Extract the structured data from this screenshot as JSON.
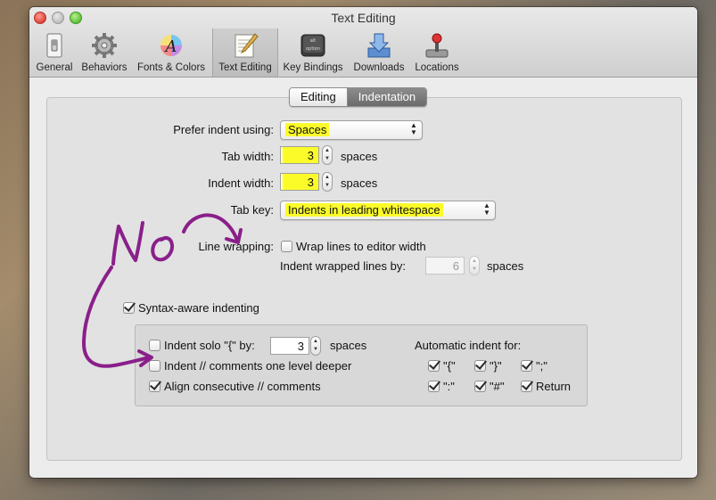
{
  "window": {
    "title": "Text Editing"
  },
  "toolbar": {
    "items": [
      {
        "label": "General",
        "icon": "light-switch-icon"
      },
      {
        "label": "Behaviors",
        "icon": "gear-icon"
      },
      {
        "label": "Fonts & Colors",
        "icon": "fonts-colors-icon"
      },
      {
        "label": "Text Editing",
        "icon": "text-editing-icon",
        "active": true
      },
      {
        "label": "Key Bindings",
        "icon": "option-key-icon"
      },
      {
        "label": "Downloads",
        "icon": "downloads-icon"
      },
      {
        "label": "Locations",
        "icon": "joystick-icon"
      }
    ]
  },
  "tabs": {
    "editing": "Editing",
    "indentation": "Indentation",
    "selected": "Indentation"
  },
  "indentation": {
    "prefer_indent_label": "Prefer indent using:",
    "prefer_indent_value": "Spaces",
    "tab_width_label": "Tab width:",
    "tab_width_value": "3",
    "tab_width_unit": "spaces",
    "indent_width_label": "Indent width:",
    "indent_width_value": "3",
    "indent_width_unit": "spaces",
    "tab_key_label": "Tab key:",
    "tab_key_value": "Indents in leading whitespace",
    "line_wrapping_label": "Line wrapping:",
    "wrap_lines_label": "Wrap lines to editor width",
    "wrap_lines_checked": false,
    "indent_wrapped_label": "Indent wrapped lines by:",
    "indent_wrapped_value": "6",
    "indent_wrapped_unit": "spaces",
    "syntax_aware_label": "Syntax-aware indenting",
    "syntax_aware_checked": true,
    "indent_solo_label": "Indent solo \"{\" by:",
    "indent_solo_checked": false,
    "indent_solo_value": "3",
    "indent_solo_unit": "spaces",
    "indent_comments_label": "Indent // comments one level deeper",
    "indent_comments_checked": false,
    "align_comments_label": "Align consecutive // comments",
    "align_comments_checked": true,
    "auto_indent_label": "Automatic indent for:",
    "auto_indent": [
      {
        "label": "\"{\"",
        "checked": true
      },
      {
        "label": "\"}\"",
        "checked": true
      },
      {
        "label": "\";\"",
        "checked": true
      },
      {
        "label": "\":\"",
        "checked": true
      },
      {
        "label": "\"#\"",
        "checked": true
      },
      {
        "label": "Return",
        "checked": true
      }
    ]
  },
  "annotation": {
    "text": "No",
    "color": "#8a1f8a"
  },
  "colors": {
    "highlight": "#fbfb2a",
    "selected_tab": "#7a7a7a"
  }
}
